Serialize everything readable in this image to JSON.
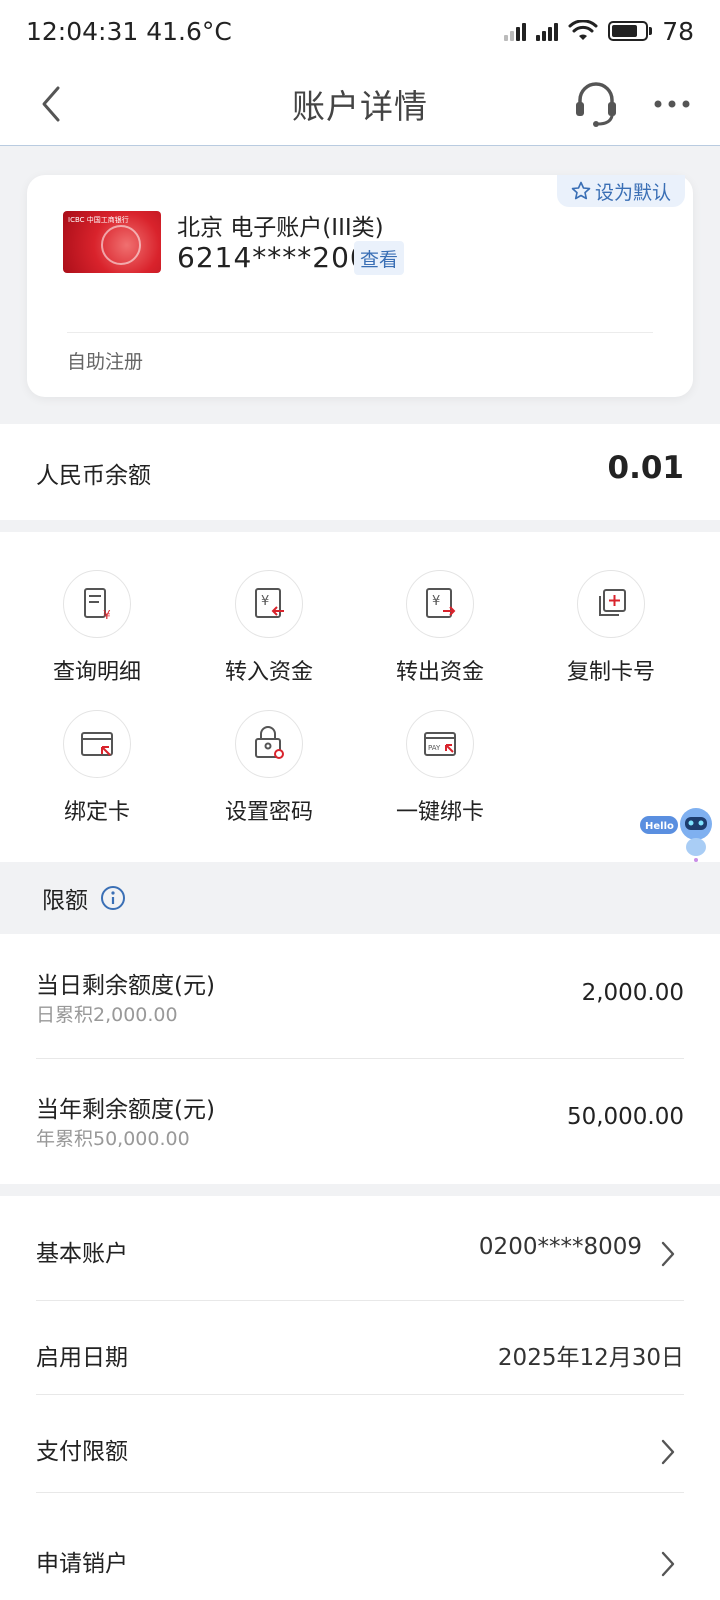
{
  "status_bar": {
    "time": "12:04:31",
    "temperature": "41.6°C",
    "battery_level": "78"
  },
  "nav": {
    "title": "账户详情",
    "back_icon": "chevron-left-icon",
    "service_icon": "headset-icon",
    "more_icon": "more-dots-icon"
  },
  "card": {
    "default_tag": "设为默认",
    "account_name": "北京 电子账户(III类)",
    "account_number": "6214****2005",
    "view_label": "查看",
    "footer": "自助注册",
    "card_brand": "ICBC 中国工商银行",
    "card_color": "#d9232c"
  },
  "balance": {
    "label": "人民币余额",
    "value": "0.01"
  },
  "actions": [
    {
      "label": "查询明细",
      "icon": "statement-yuan-icon"
    },
    {
      "label": "转入资金",
      "icon": "transfer-in-icon"
    },
    {
      "label": "转出资金",
      "icon": "transfer-out-icon"
    },
    {
      "label": "复制卡号",
      "icon": "copy-icon"
    },
    {
      "label": "绑定卡",
      "icon": "bind-card-icon"
    },
    {
      "label": "设置密码",
      "icon": "lock-settings-icon"
    },
    {
      "label": "一键绑卡",
      "icon": "pay-card-icon"
    }
  ],
  "assistant": {
    "bubble": "Hello",
    "icon": "robot-assistant-icon"
  },
  "limits": {
    "title": "限额",
    "rows": [
      {
        "title": "当日剩余额度(元)",
        "sub": "日累积2,000.00",
        "value": "2,000.00"
      },
      {
        "title": "当年剩余额度(元)",
        "sub": "年累积50,000.00",
        "value": "50,000.00"
      }
    ]
  },
  "info": [
    {
      "title": "基本账户",
      "value": "0200****8009"
    },
    {
      "title": "启用日期",
      "value": "2025年12月30日"
    },
    {
      "title": "支付限额",
      "value": ""
    },
    {
      "title": "申请销户",
      "value": ""
    }
  ],
  "colors": {
    "accent": "#3a6fb5",
    "icon_red": "#d9232c",
    "background": "#f1f2f4"
  }
}
